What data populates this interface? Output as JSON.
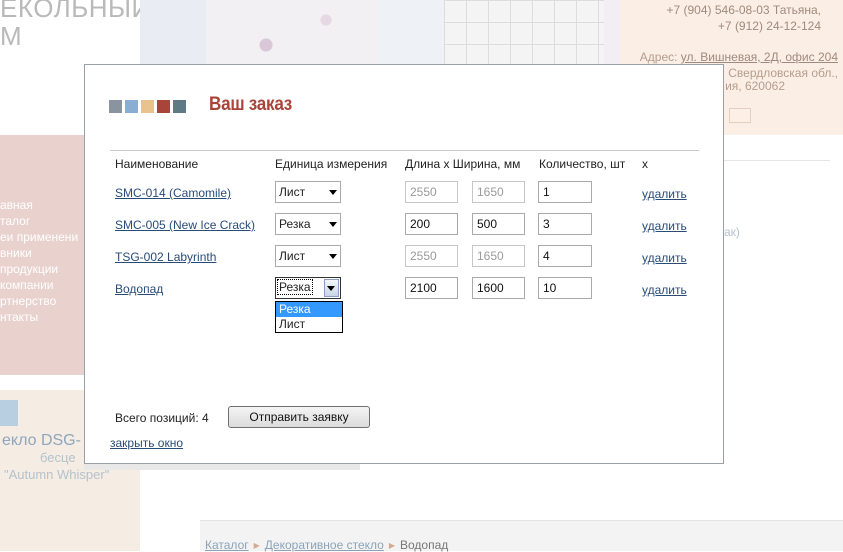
{
  "background": {
    "logo_lines": [
      "ЕКОЛЬНЫЙ",
      "М"
    ],
    "contact_lines": [
      "+7 (904) 546-08-03 Татьяна,",
      "+7 (912) 24-12-124"
    ],
    "address_label": "Адрес: ",
    "address_link": "ул. Вишневая, 2Д, офис 204",
    "address_line2": "Свердловская обл.,",
    "address_line3": "ия, 620062",
    "menu_items": [
      "авная",
      "талог",
      "еи применени",
      "вники",
      "продукции",
      "компании",
      "ртнерство",
      "нтакты"
    ],
    "promo": {
      "line1": "екло DSG-",
      "line2": "бесце",
      "line3": "\"Autumn Whisper\""
    },
    "right_link": "ак)",
    "breadcrumb": {
      "items": [
        "Каталог",
        "Декоративное стекло"
      ],
      "current": "Водопад"
    }
  },
  "dialog": {
    "title": "Ваш заказ",
    "squares_colors": [
      "#8a93a0",
      "#8aaed3",
      "#e8c38e",
      "#a8443a",
      "#5f7a84"
    ],
    "columns": {
      "name": "Наименование",
      "unit": "Единица измерения",
      "size": "Длина х Ширина, мм",
      "qty": "Количество, шт",
      "x": "x"
    },
    "rows": [
      {
        "name": "SMC-014 (Camomile)",
        "unit": "Лист",
        "length": "2550",
        "width": "1650",
        "qty": "1",
        "delete": "удалить"
      },
      {
        "name": "SMC-005 (New Ice Crack)",
        "unit": "Резка",
        "length": "200",
        "width": "500",
        "qty": "3",
        "delete": "удалить"
      },
      {
        "name": "TSG-002 Labyrinth",
        "unit": "Лист",
        "length": "2550",
        "width": "1650",
        "qty": "4",
        "delete": "удалить"
      },
      {
        "name": "Водопад",
        "unit": "Резка",
        "length": "2100",
        "width": "1600",
        "qty": "10",
        "delete": "удалить"
      }
    ],
    "dropdown_options": [
      "Резка",
      "Лист"
    ],
    "total_label": "Всего позиций: 4",
    "submit_label": "Отправить заявку",
    "close_label": "закрыть окно"
  }
}
